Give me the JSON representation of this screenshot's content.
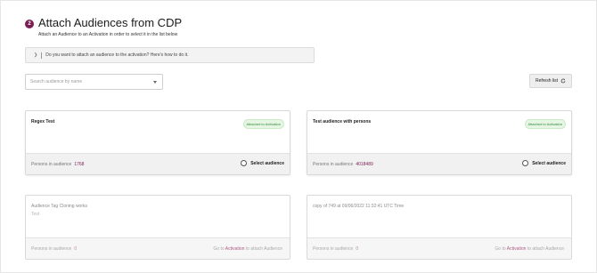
{
  "header": {
    "step_number": "2",
    "title": "Attach Audiences from CDP",
    "subtitle": "Attach an Audience to an Activation in order to select it in the list below"
  },
  "info": {
    "text": "Do you want to attach an audience to the activation? Here's how to do it."
  },
  "search": {
    "placeholder": "Search audience by name",
    "value": ""
  },
  "refresh": {
    "label": "Refresh list",
    "icon": "refresh-icon"
  },
  "colors": {
    "accent": "#7b1d52",
    "badge_bg": "#e7f6e4",
    "badge_text": "#2f8a3a"
  },
  "cards": [
    {
      "name": "Regex Test",
      "description": "",
      "badge": "Attached to Activation",
      "persons_label": "Persons in audience",
      "persons_count": "1768",
      "action_label": "Select audience"
    },
    {
      "name": "Test audience with persons",
      "description": "",
      "badge": "Attached to Activation",
      "persons_label": "Persons in audience",
      "persons_count": "4018489",
      "action_label": "Select audience"
    },
    {
      "name": "Audience Tag Cloning works",
      "description": "Test",
      "persons_label": "Persons in audience",
      "persons_count": "0",
      "goto_prefix": "Go to",
      "goto_link": "Activation",
      "goto_suffix": "to attach Audience"
    },
    {
      "name": "copy of 749 at 09/06/2022 11:32:41 UTC Time",
      "description": "",
      "persons_label": "Persons in audience",
      "persons_count": "0",
      "goto_prefix": "Go to",
      "goto_link": "Activation",
      "goto_suffix": "to attach Audience"
    }
  ]
}
